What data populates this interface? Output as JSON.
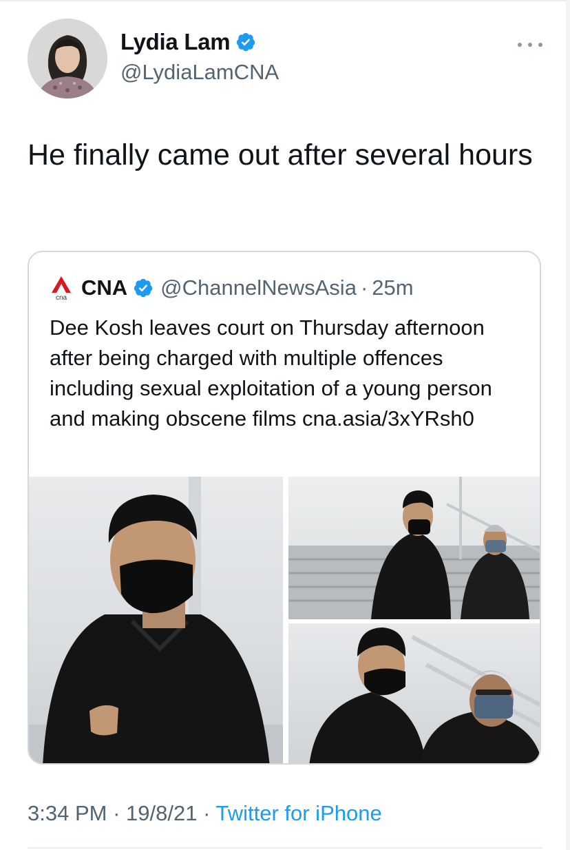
{
  "author": {
    "display_name": "Lydia Lam",
    "handle": "@LydiaLamCNA",
    "verified_icon": "verified-badge-icon"
  },
  "tweet": {
    "text": "He finally came out after several hours"
  },
  "quoted_tweet": {
    "display_name": "CNA",
    "handle": "@ChannelNewsAsia",
    "separator": "·",
    "time_ago": "25m",
    "text": "Dee Kosh leaves court on Thursday afternoon after being charged with multiple offences including sexual exploitation of a young person and making obscene films cna.asia/3xYRsh0",
    "photo_count": 3
  },
  "meta": {
    "time": "3:34 PM",
    "dot1": "·",
    "date": "19/8/21",
    "dot2": "·",
    "source": "Twitter for iPhone"
  },
  "colors": {
    "accent": "#1d9bf0",
    "secondary_text": "#536471",
    "primary_text": "#0f1419",
    "border": "#cfd9de",
    "cna_red": "#d71920"
  }
}
